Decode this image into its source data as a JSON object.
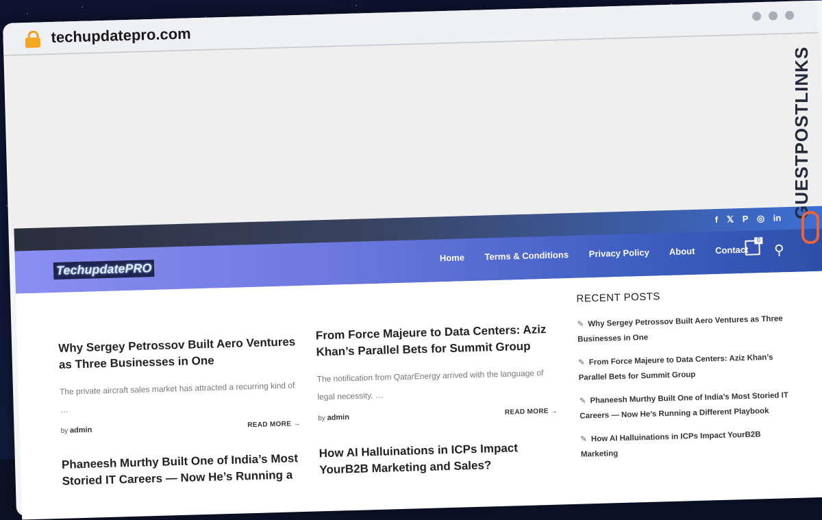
{
  "browser": {
    "domain": "techupdatepro.com"
  },
  "topbar": {
    "social": [
      "f",
      "𝕏",
      "P",
      "◎",
      "in"
    ]
  },
  "header": {
    "logo": "TechupdatePRO",
    "nav": [
      "Home",
      "Terms & Conditions",
      "Privacy Policy",
      "About",
      "Contact"
    ],
    "cart_count": "0"
  },
  "posts": [
    {
      "title": "Why Sergey Petrossov Built Aero Ventures as Three Businesses in One",
      "excerpt": "The private aircraft sales market has attracted a recurring kind of …",
      "by": "by",
      "author": "admin",
      "readmore": "READ MORE →"
    },
    {
      "title": "From Force Majeure to Data Centers: Aziz Khan’s Parallel Bets for Summit Group",
      "excerpt": "The notification from QatarEnergy arrived with the language of legal necessity. …",
      "by": "by",
      "author": "admin",
      "readmore": "READ MORE →"
    },
    {
      "title": "Phaneesh Murthy Built One of India’s Most Storied IT Careers — Now He’s Running a"
    },
    {
      "title": "How AI Halluinations in ICPs Impact YourB2B Marketing and Sales?"
    }
  ],
  "sidebar": {
    "heading": "RECENT POSTS",
    "items": [
      "Why Sergey Petrossov Built Aero Ventures as Three Businesses in One",
      "From Force Majeure to Data Centers: Aziz Khan’s Parallel Bets for Summit Group",
      "Phaneesh Murthy Built One of India’s Most Storied IT Careers — Now He’s Running a Different Playbook",
      "How AI Halluinations in ICPs Impact YourB2B Marketing"
    ]
  },
  "brand": {
    "text": "GUESTPOSTLINKS"
  }
}
